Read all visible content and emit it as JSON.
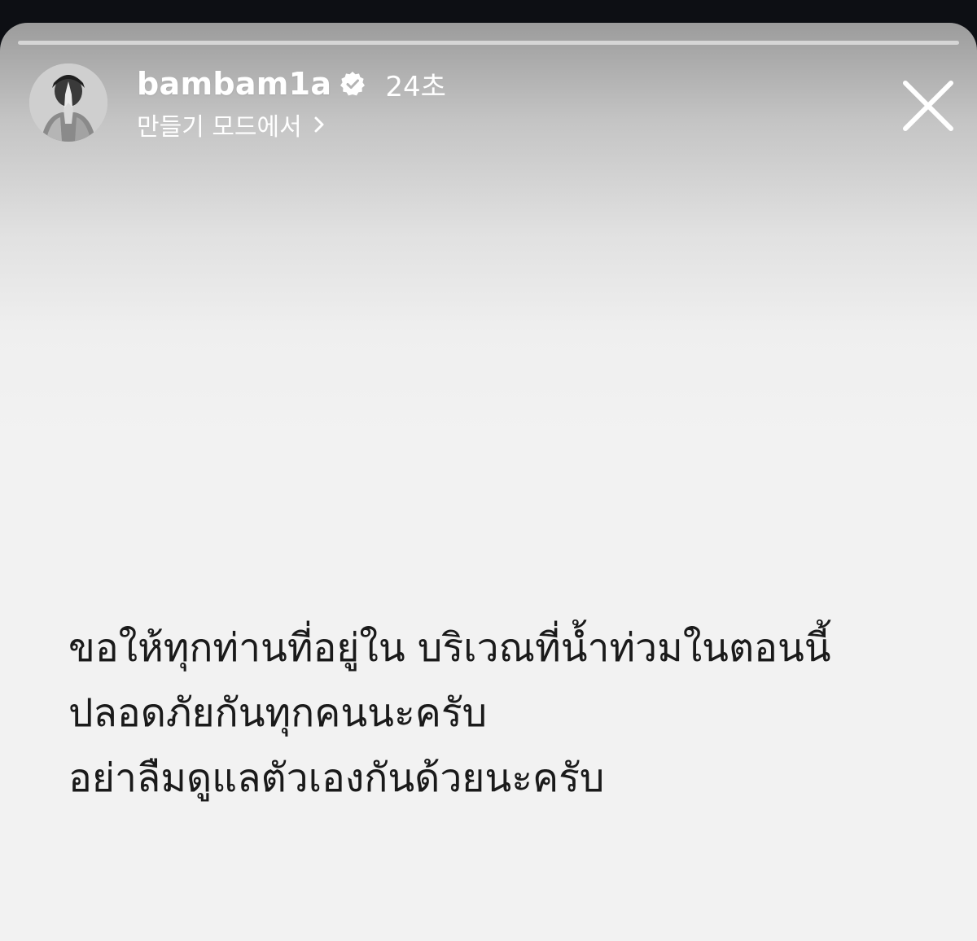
{
  "story": {
    "progress": 0.0,
    "user": {
      "username": "bambam1a",
      "verified_icon": "verified-badge-icon",
      "time_ago": "24초",
      "subtitle": "만들기 모드에서",
      "avatar_icon": "avatar"
    },
    "close_icon": "close-icon",
    "message_lines": [
      "ขอให้ทุกท่านที่อยู่ใน บริเวณที่น้ำท่วมในตอนนี้",
      "ปลอดภัยกันทุกคนนะครับ",
      "อย่าลืมดูแลตัวเองกันด้วยนะครับ"
    ]
  },
  "colors": {
    "header_text": "#ffffff",
    "message_text": "#1a1a1a",
    "background": "#f2f2f2"
  }
}
